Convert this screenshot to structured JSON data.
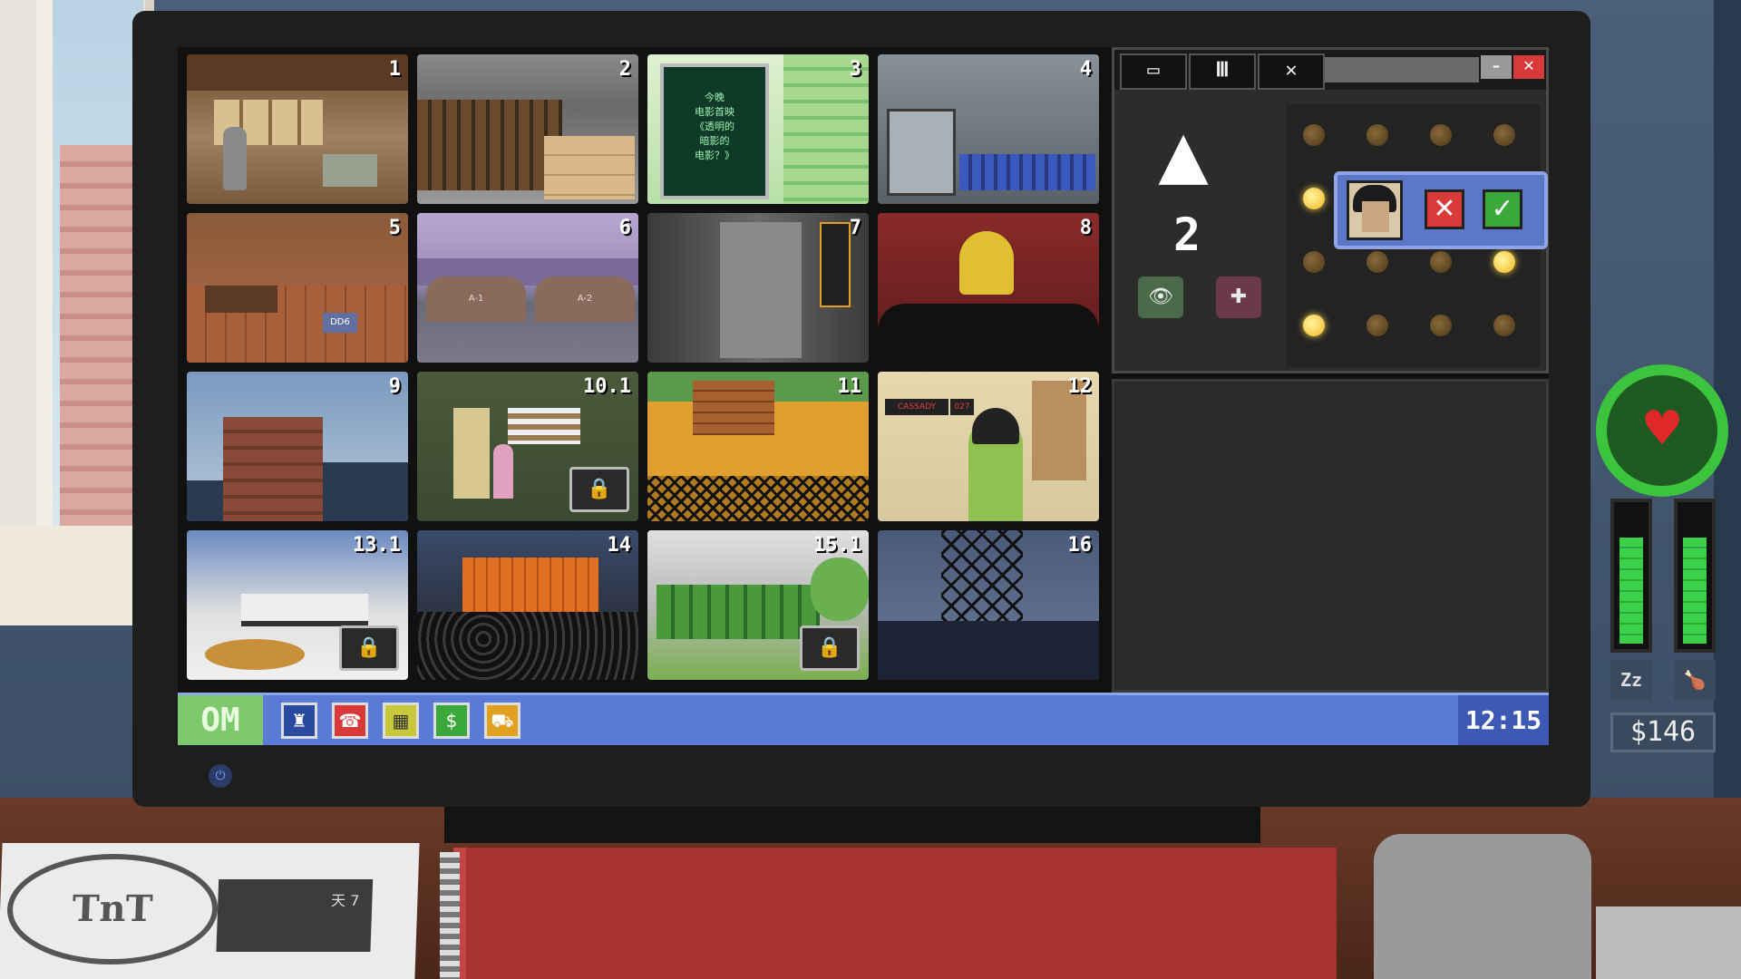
{
  "cameras": [
    {
      "id": "1",
      "locked": false
    },
    {
      "id": "2",
      "locked": false
    },
    {
      "id": "3",
      "locked": false
    },
    {
      "id": "4",
      "locked": false
    },
    {
      "id": "5",
      "locked": false
    },
    {
      "id": "6",
      "locked": false
    },
    {
      "id": "7",
      "locked": false
    },
    {
      "id": "8",
      "locked": false
    },
    {
      "id": "9",
      "locked": false
    },
    {
      "id": "10.1",
      "locked": true
    },
    {
      "id": "11",
      "locked": false
    },
    {
      "id": "12",
      "locked": false
    },
    {
      "id": "13.1",
      "locked": true
    },
    {
      "id": "14",
      "locked": false
    },
    {
      "id": "15.1",
      "locked": true
    },
    {
      "id": "16",
      "locked": false
    }
  ],
  "cam3_sign": {
    "line1": "今晚",
    "line2": "电影首映",
    "line3": "《透明的",
    "line4": "暗影的",
    "line5": "电影？》"
  },
  "cam6_hangars": {
    "left": "A-1",
    "right": "A-2"
  },
  "cam12_screen": {
    "label": "CASSADY",
    "counter": "027"
  },
  "cam5_sign": "DD6",
  "cult_panel": {
    "count": "2",
    "dots_on": [
      4,
      11,
      12
    ],
    "request": {
      "reject_label": "✕",
      "accept_label": "✓"
    }
  },
  "window_controls": {
    "minimize": "–",
    "close": "✕"
  },
  "taskbar": {
    "start_label": "OM",
    "clock": "12:15"
  },
  "status": {
    "health_fraction": 0.92,
    "sleep_level": 0.78,
    "food_level": 0.78,
    "sleep_label": "Zz",
    "money": "$146"
  },
  "newspaper": {
    "logo": "TnT",
    "headline": "天 7"
  },
  "colors": {
    "taskbar": "#5a7ad6",
    "health": "#3cc43e",
    "accent_yellow": "#f2b820"
  }
}
